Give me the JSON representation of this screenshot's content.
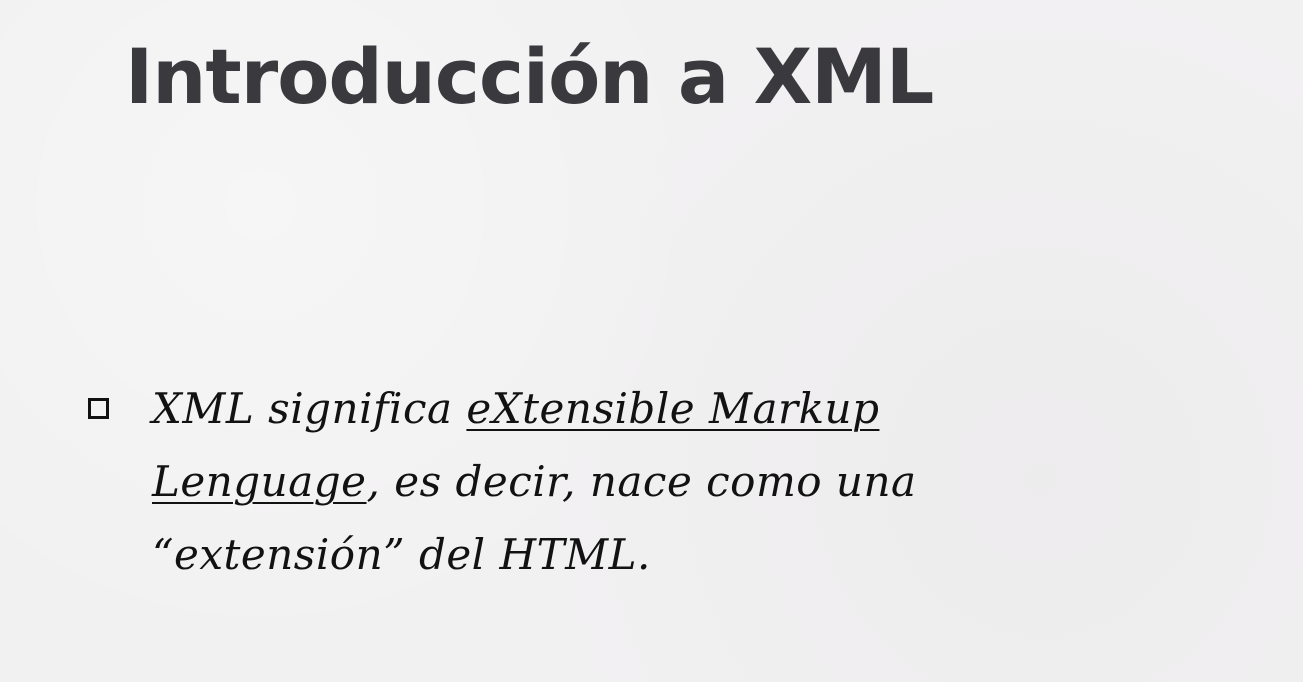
{
  "slide": {
    "title": "Introducción a XML",
    "bullets": [
      {
        "icon": "hollow-square-bullet-icon",
        "text_part1": "XML significa ",
        "text_underlined": "eXtensible Markup Lenguage",
        "text_part2": ", es decir, nace como una “extensión” del HTML."
      }
    ]
  },
  "colors": {
    "background": "#f2f1f2",
    "title": "#3a393d",
    "body_text": "#121212"
  }
}
